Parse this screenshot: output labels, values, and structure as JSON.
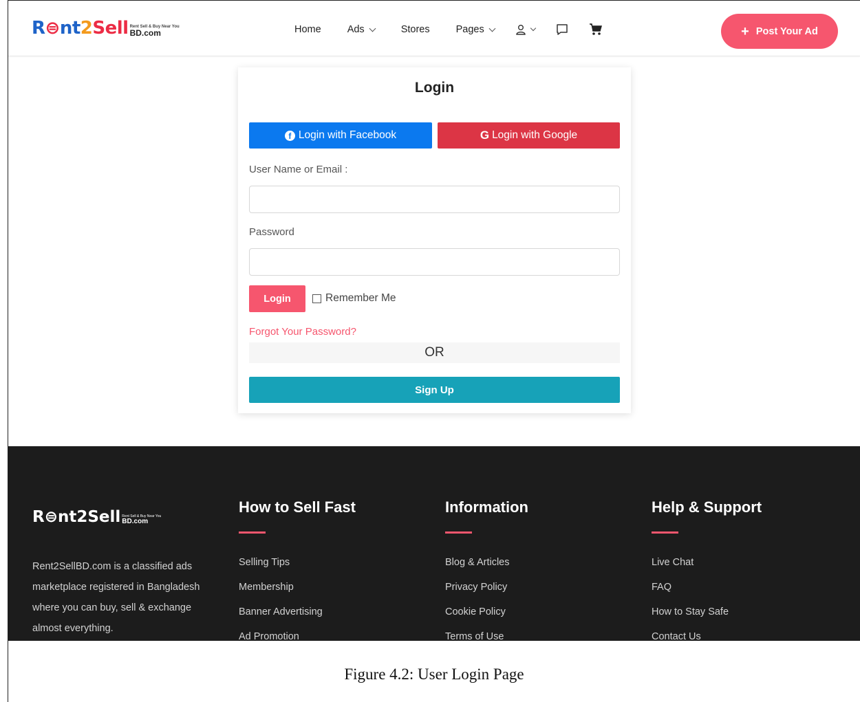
{
  "brand": {
    "logo_part1": "R",
    "logo_part2": "⊜",
    "logo_part3": "nt",
    "logo_part4": "2",
    "logo_part5": "Sell",
    "logo_tagline": "Rent Sell & Buy Near You",
    "logo_domain": "BD.com",
    "colors": {
      "accent": "#f6566e",
      "facebook": "#0b79ef",
      "google": "#dc3545",
      "signup": "#17a2b8",
      "footer_bg": "#1c1c1c"
    }
  },
  "nav": {
    "home": "Home",
    "ads": "Ads",
    "stores": "Stores",
    "pages": "Pages",
    "icons": [
      "user-icon",
      "chat-icon",
      "cart-icon"
    ],
    "post_ad": "Post Your Ad",
    "post_ad_icon": "+"
  },
  "login": {
    "title": "Login",
    "facebook": "Login with Facebook",
    "facebook_icon": "f",
    "google": "Login with Google",
    "google_icon": "G",
    "username_label": "User Name or Email :",
    "username_value": "",
    "password_label": "Password",
    "password_value": "",
    "submit": "Login",
    "remember": "Remember Me",
    "forgot": "Forgot Your Password?",
    "or": "OR",
    "signup": "Sign Up"
  },
  "footer": {
    "logo_word": "R⊜nt2Sell",
    "logo_tagline": "Rent Sell & Buy Near You",
    "logo_domain": "BD.com",
    "about": "Rent2SellBD.com is a classified ads marketplace registered in Bangladesh where you can buy, sell & exchange almost everything.",
    "columns": [
      {
        "title": "How to Sell Fast",
        "links": [
          "Selling Tips",
          "Membership",
          "Banner Advertising",
          "Ad Promotion"
        ]
      },
      {
        "title": "Information",
        "links": [
          "Blog & Articles",
          "Privacy Policy",
          "Cookie Policy",
          "Terms of Use"
        ]
      },
      {
        "title": "Help & Support",
        "links": [
          "Live Chat",
          "FAQ",
          "How to Stay Safe",
          "Contact Us"
        ]
      }
    ]
  },
  "caption": "Figure 4.2: User Login Page"
}
